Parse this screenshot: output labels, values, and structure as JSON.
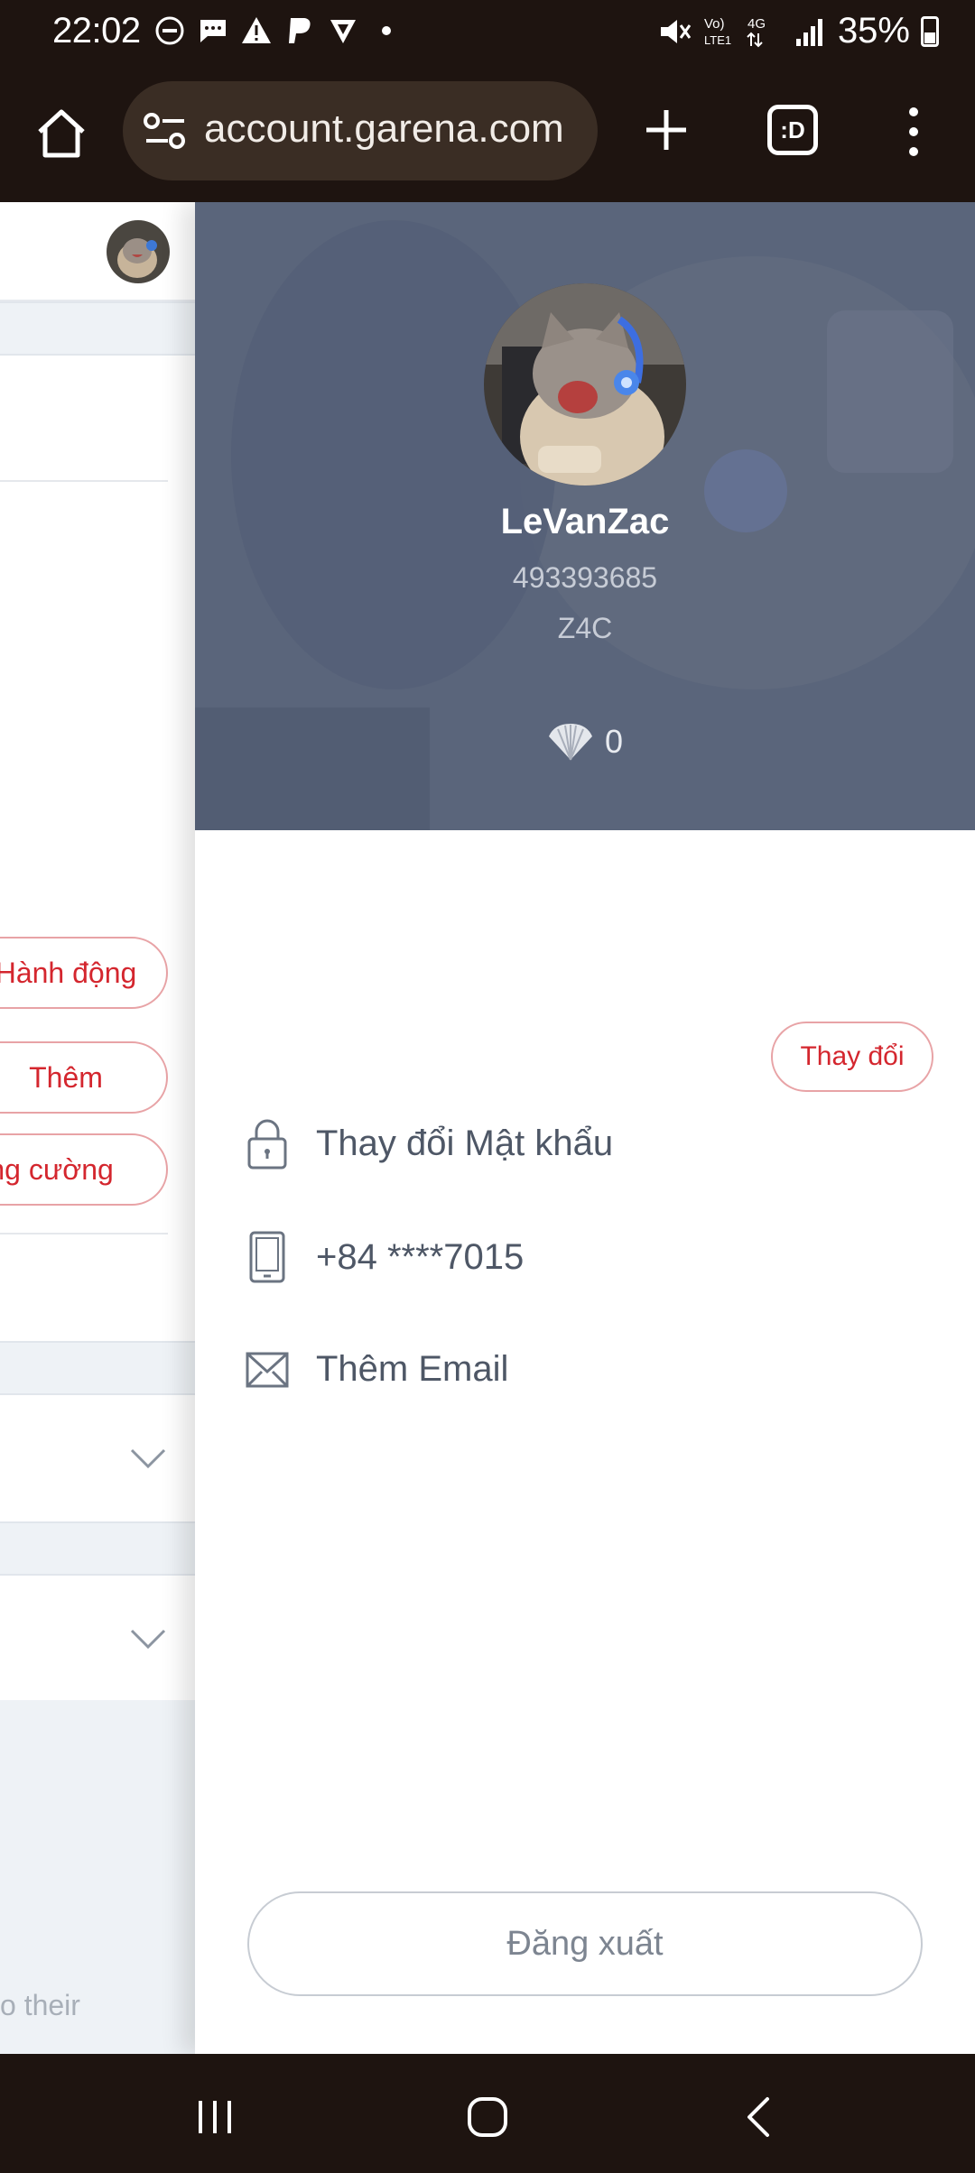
{
  "status_bar": {
    "time": "22:02",
    "network": "Vo) LTE1 4G",
    "battery_percent": "35%"
  },
  "browser": {
    "url": "account.garena.com",
    "tab_switcher_label": ":D"
  },
  "background_page": {
    "buttons": [
      "Hành động",
      "Thêm",
      "Tăng cường"
    ],
    "footer_text": "o their"
  },
  "profile": {
    "username": "LeVanZac",
    "user_id": "493393685",
    "region": "Z4C",
    "shells": "0"
  },
  "account_items": [
    {
      "icon": "lock-icon",
      "label": "Thay đổi Mật khẩu"
    },
    {
      "icon": "phone-icon",
      "label": "+84 ****7015"
    },
    {
      "icon": "mail-icon",
      "label": "Thêm Email"
    }
  ],
  "phone_change_button": "Thay đổi",
  "logout_label": "Đăng xuất",
  "colors": {
    "accent": "#d4262e",
    "hero_bg": "#5e6a82",
    "chrome_bg": "#1e1410"
  }
}
